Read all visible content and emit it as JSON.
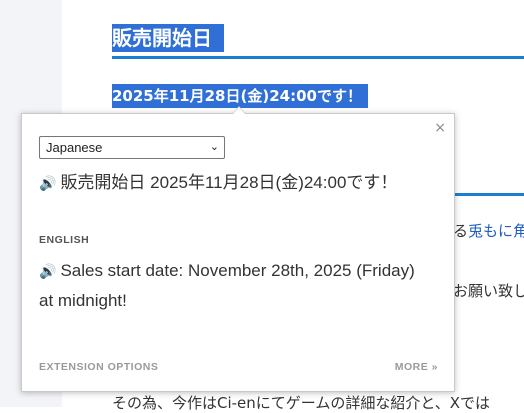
{
  "page": {
    "heading": "販売開始日",
    "date_line": "2025年11月28日(金)24:00です！",
    "side_line_1_pre": "る",
    "side_line_1_link": "兎もに角",
    "side_line_2": "お願い致し",
    "bottom_line": "その為、今作はCi-enにてゲームの詳細な紹介と、Xでは"
  },
  "popup": {
    "close_label": "×",
    "language_select": {
      "selected": "Japanese",
      "chevron": "⌄"
    },
    "source": {
      "speaker_icon": "🔊",
      "text": "販売開始日 2025年11月28日(金)24:00です！"
    },
    "target_language_label": "ENGLISH",
    "translation": {
      "speaker_icon": "🔊",
      "text": "Sales start date: November 28th, 2025 (Friday) at midnight!"
    },
    "footer": {
      "options_label": "EXTENSION OPTIONS",
      "more_label": "MORE »"
    }
  },
  "colors": {
    "highlight": "#2f6fd6",
    "rule": "#1a7fd0",
    "link": "#1f5fbf"
  }
}
